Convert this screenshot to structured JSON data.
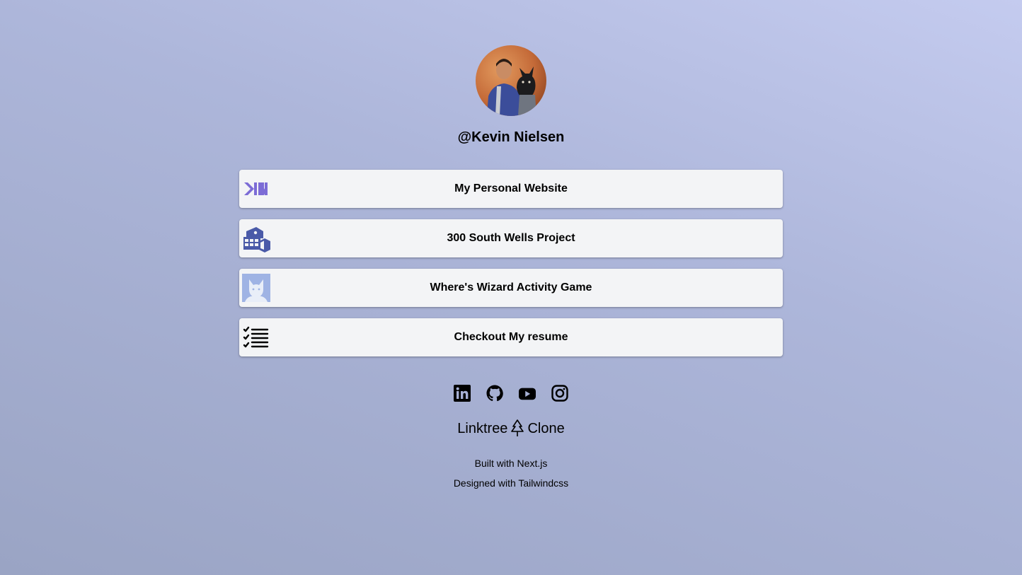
{
  "profile": {
    "handle": "@Kevin Nielsen"
  },
  "links": [
    {
      "label": "My Personal Website",
      "icon": "kn-logo-icon"
    },
    {
      "label": "300 South Wells Project",
      "icon": "building-icon"
    },
    {
      "label": "Where's Wizard Activity Game",
      "icon": "wizard-cat-icon"
    },
    {
      "label": "Checkout My resume",
      "icon": "checklist-icon"
    }
  ],
  "socials": [
    {
      "icon": "linkedin-icon"
    },
    {
      "icon": "github-icon"
    },
    {
      "icon": "youtube-icon"
    },
    {
      "icon": "instagram-icon"
    }
  ],
  "brand": {
    "left": "Linktree",
    "right": "Clone",
    "icon": "tree-icon"
  },
  "footer": {
    "built_with": "Built with Next.js",
    "designed_with": "Designed with Tailwindcss"
  },
  "colors": {
    "background_top": "#c4cbef",
    "background_bottom": "#9aa4c4",
    "card": "#f3f4f6",
    "kn_logo": "#7c6cd6",
    "building": "#4a5aa8"
  }
}
